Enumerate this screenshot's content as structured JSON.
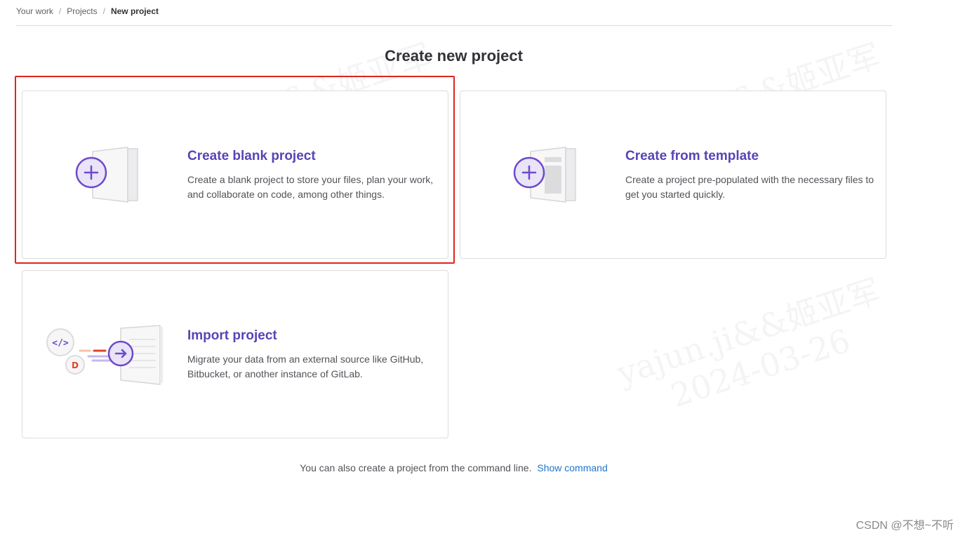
{
  "breadcrumb": {
    "items": [
      "Your work",
      "Projects"
    ],
    "current": "New project"
  },
  "page_title": "Create new project",
  "cards": {
    "blank": {
      "title": "Create blank project",
      "description": "Create a blank project to store your files, plan your work, and collaborate on code, among other things.",
      "icon": "blank-project-illustration"
    },
    "template": {
      "title": "Create from template",
      "description": "Create a project pre-populated with the necessary files to get you started quickly.",
      "icon": "template-project-illustration"
    },
    "import": {
      "title": "Import project",
      "description": "Migrate your data from an external source like GitHub, Bitbucket, or another instance of GitLab.",
      "icon": "import-project-illustration"
    }
  },
  "cli_hint": {
    "text": "You can also create a project from the command line.",
    "link": "Show command"
  },
  "watermark": {
    "line1": "yajun.ji&&姬亚军",
    "line2": "2024-03-26"
  },
  "csdn_mark": "CSDN @不想~不听",
  "colors": {
    "accent": "#5943b6",
    "highlight": "#e0251b",
    "link": "#1f75cb"
  }
}
